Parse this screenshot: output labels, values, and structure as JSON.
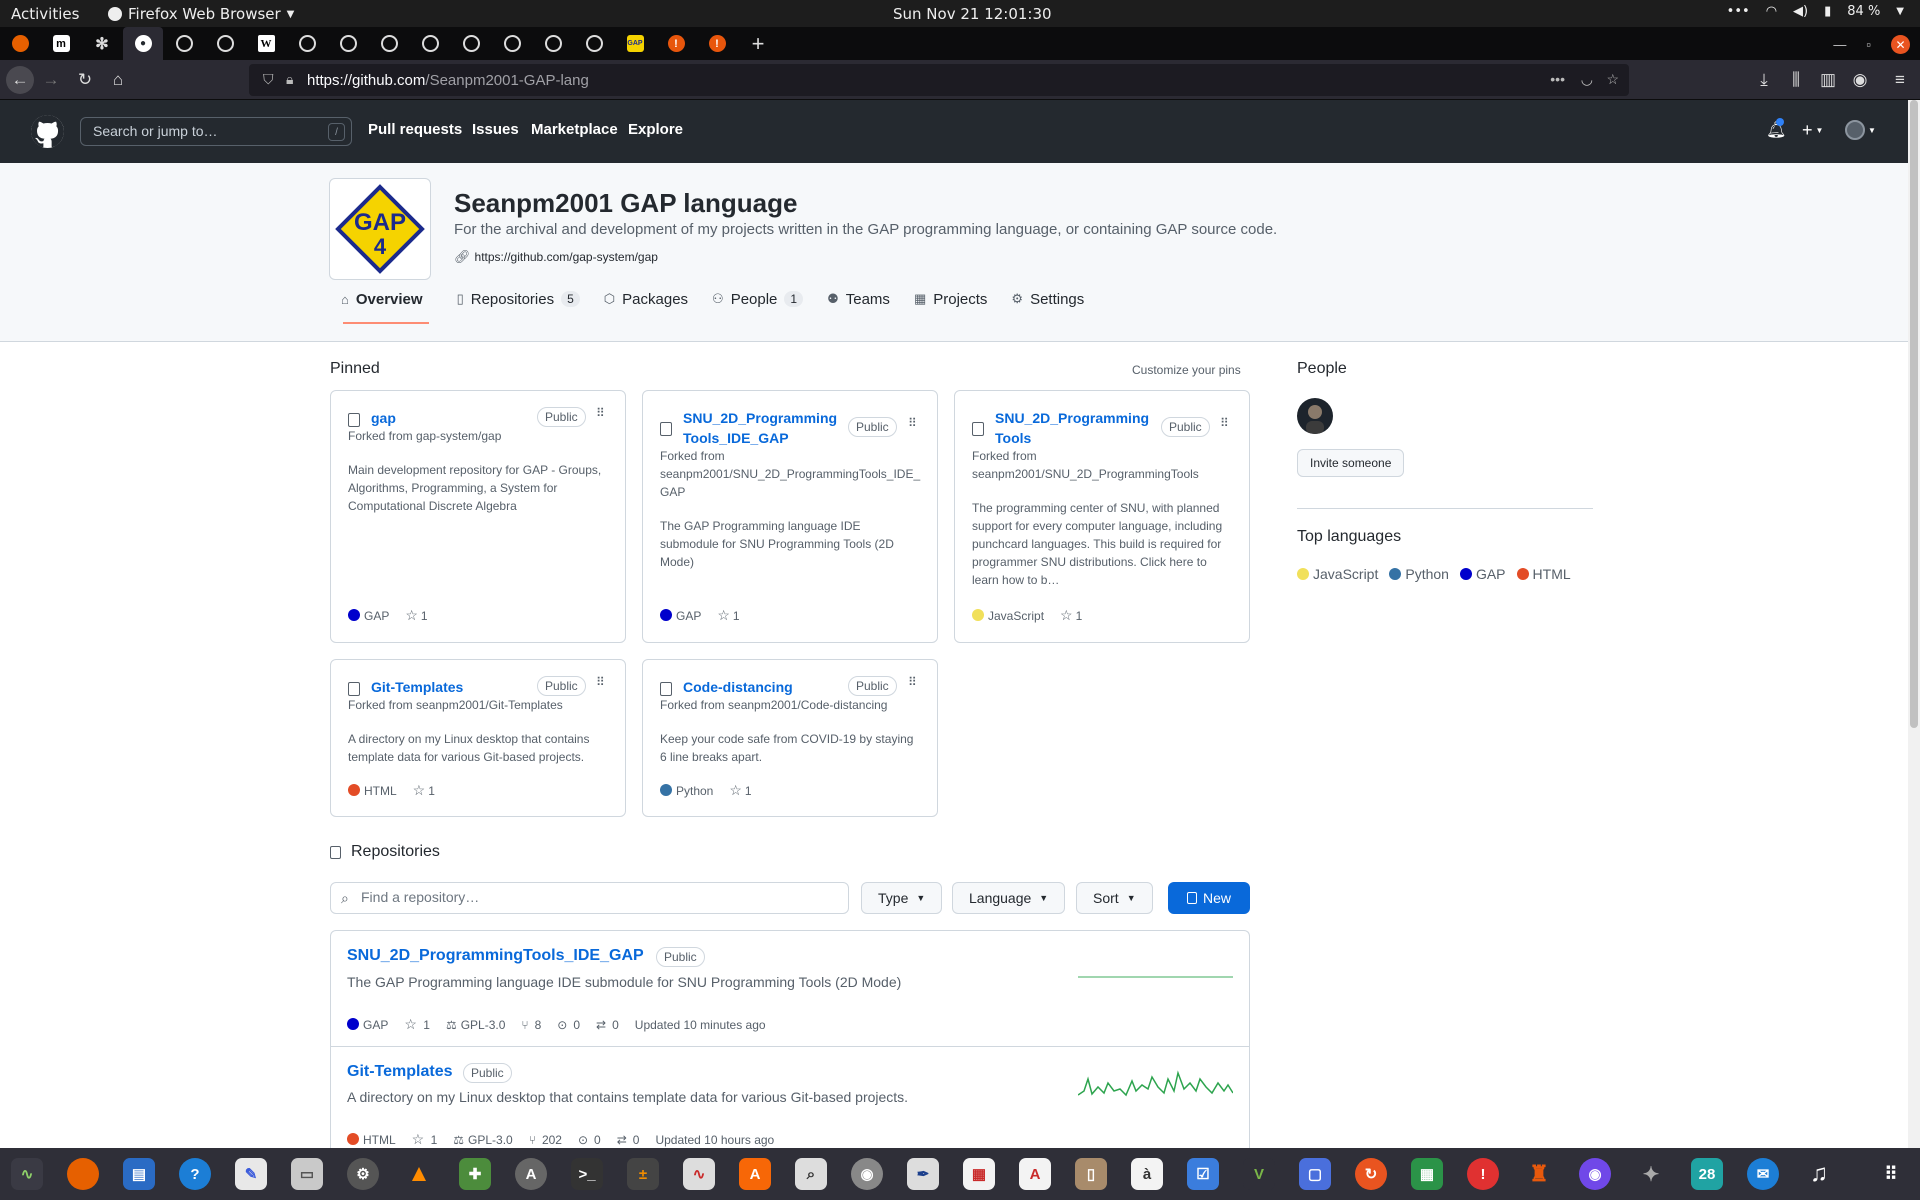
{
  "gnome": {
    "activities": "Activities",
    "app_name": "Firefox Web Browser",
    "clock": "Sun Nov 21  12:01:30",
    "battery": "84 %"
  },
  "browser": {
    "url_host": "https://github.com",
    "url_path": "/Seanpm2001-GAP-lang"
  },
  "gh_header": {
    "search_placeholder": "Search or jump to…",
    "slash": "/",
    "nav": [
      "Pull requests",
      "Issues",
      "Marketplace",
      "Explore"
    ]
  },
  "org": {
    "logo_text": "GAP 4",
    "name": "Seanpm2001 GAP language",
    "description": "For the archival and development of my projects written in the GAP programming language, or containing GAP source code.",
    "link": "https://github.com/gap-system/gap",
    "tabs": [
      {
        "label": "Overview",
        "count": ""
      },
      {
        "label": "Repositories",
        "count": "5"
      },
      {
        "label": "Packages",
        "count": ""
      },
      {
        "label": "People",
        "count": "1"
      },
      {
        "label": "Teams",
        "count": ""
      },
      {
        "label": "Projects",
        "count": ""
      },
      {
        "label": "Settings",
        "count": ""
      }
    ]
  },
  "pinned": {
    "title": "Pinned",
    "customize": "Customize your pins",
    "cards": [
      {
        "name": "gap",
        "badge": "Public",
        "forked_from": "Forked from gap-system/gap",
        "description": "Main development repository for GAP - Groups, Algorithms, Programming, a System for Computational Discrete Algebra",
        "language": "GAP",
        "stars": "1"
      },
      {
        "name": "SNU_2D_Programming Tools_IDE_GAP",
        "badge": "Public",
        "forked_from": "Forked from seanpm2001/SNU_2D_ProgrammingTools_IDE_ GAP",
        "description": "The GAP Programming language IDE submodule for SNU Programming Tools (2D Mode)",
        "language": "GAP",
        "stars": "1"
      },
      {
        "name": "SNU_2D_Programming Tools",
        "badge": "Public",
        "forked_from": "Forked from seanpm2001/SNU_2D_ProgrammingTools",
        "description": "The programming center of SNU, with planned support for every computer language, including punchcard languages. This build is required for programmer SNU distributions. Click here to learn how to b…",
        "language": "JavaScript",
        "stars": "1"
      },
      {
        "name": "Git-Templates",
        "badge": "Public",
        "forked_from": "Forked from seanpm2001/Git-Templates",
        "description": "A directory on my Linux desktop that contains template data for various Git-based projects.",
        "language": "HTML",
        "stars": "1"
      },
      {
        "name": "Code-distancing",
        "badge": "Public",
        "forked_from": "Forked from seanpm2001/Code-distancing",
        "description": "Keep your code safe from COVID-19 by staying 6 line breaks apart.",
        "language": "Python",
        "stars": "1"
      }
    ]
  },
  "sidebar": {
    "people_title": "People",
    "invite_label": "Invite someone",
    "top_languages_title": "Top languages",
    "top_languages": [
      "JavaScript",
      "Python",
      "GAP",
      "HTML"
    ]
  },
  "repositories": {
    "title": "Repositories",
    "search_placeholder": "Find a repository…",
    "type_label": "Type",
    "language_label": "Language",
    "sort_label": "Sort",
    "new_label": "New",
    "items": [
      {
        "name": "SNU_2D_ProgrammingTools_IDE_GAP",
        "badge": "Public",
        "description": "The GAP Programming language IDE submodule for SNU Programming Tools (2D Mode)",
        "language": "GAP",
        "stars": "1",
        "license": "GPL-3.0",
        "forks": "8",
        "issues": "0",
        "pulls": "0",
        "updated": "Updated 10 minutes ago"
      },
      {
        "name": "Git-Templates",
        "badge": "Public",
        "description": "A directory on my Linux desktop that contains template data for various Git-based projects.",
        "language": "HTML",
        "stars": "1",
        "license": "GPL-3.0",
        "forks": "202",
        "issues": "0",
        "pulls": "0",
        "updated": "Updated 10 hours ago"
      }
    ]
  },
  "colors": {
    "GAP": "#0000cc",
    "JavaScript": "#f1e05a",
    "Python": "#3572a5",
    "HTML": "#e34c26",
    "link": "#0969da",
    "primary_button": "#0969da",
    "activity_line": "#2da44e"
  },
  "icons": {
    "tabs": [
      "firefox-icon",
      "medium-icon",
      "gear-icon",
      "github-icon",
      "wikipedia-icon",
      "gap-icon",
      "brave-icon"
    ],
    "dock": [
      "system-monitor-icon",
      "firefox-icon",
      "writer-icon",
      "help-icon",
      "text-editor-icon",
      "files-icon",
      "settings-icon",
      "vlc-icon",
      "puzzle-icon",
      "software-icon",
      "terminal-icon",
      "calculator-icon",
      "graph-icon",
      "app-store-icon",
      "search-icon",
      "disk-icon",
      "inkscape-icon",
      "impress-icon",
      "reader-icon",
      "archive-icon",
      "font-icon",
      "tasks-icon",
      "vim-icon",
      "screenshot-icon",
      "update-icon",
      "calc-icon",
      "alert-icon",
      "game-icon",
      "camera-icon",
      "bug-icon",
      "calendar-icon",
      "thunderbird-icon",
      "music-icon",
      "app-grid-icon"
    ]
  },
  "taskbar": {
    "calendar_day": "28"
  }
}
